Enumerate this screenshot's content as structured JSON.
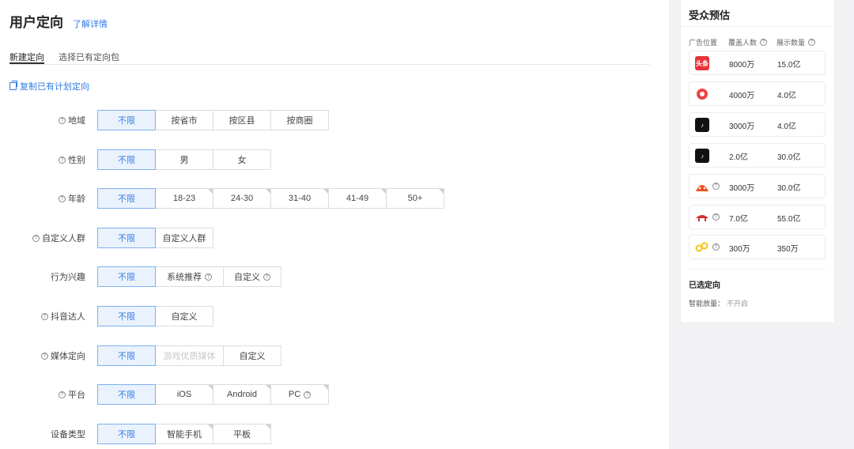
{
  "header": {
    "title": "用户定向",
    "detail_link": "了解详情"
  },
  "tabs": [
    {
      "label": "新建定向",
      "active": true
    },
    {
      "label": "选择已有定向包",
      "active": false
    }
  ],
  "copy_link": "复制已有计划定向",
  "rows": [
    {
      "label": "地域",
      "help": true,
      "options": [
        {
          "label": "不限",
          "selected": true
        },
        {
          "label": "按省市"
        },
        {
          "label": "按区县"
        },
        {
          "label": "按商圈"
        }
      ]
    },
    {
      "label": "性别",
      "help": true,
      "options": [
        {
          "label": "不限",
          "selected": true
        },
        {
          "label": "男"
        },
        {
          "label": "女"
        }
      ]
    },
    {
      "label": "年龄",
      "help": true,
      "options": [
        {
          "label": "不限",
          "selected": true
        },
        {
          "label": "18-23",
          "corner": true
        },
        {
          "label": "24-30",
          "corner": true
        },
        {
          "label": "31-40",
          "corner": true
        },
        {
          "label": "41-49",
          "corner": true
        },
        {
          "label": "50+",
          "corner": true
        }
      ]
    },
    {
      "label": "自定义人群",
      "help": true,
      "options": [
        {
          "label": "不限",
          "selected": true
        },
        {
          "label": "自定义人群"
        }
      ]
    },
    {
      "label": "行为兴趣",
      "help": false,
      "options": [
        {
          "label": "不限",
          "selected": true
        },
        {
          "label": "系统推荐",
          "help": true,
          "wide": true
        },
        {
          "label": "自定义",
          "help": true
        }
      ]
    },
    {
      "label": "抖音达人",
      "help": true,
      "options": [
        {
          "label": "不限",
          "selected": true
        },
        {
          "label": "自定义"
        }
      ]
    },
    {
      "label": "媒体定向",
      "help": true,
      "options": [
        {
          "label": "不限",
          "selected": true
        },
        {
          "label": "游戏优质媒体",
          "disabled": true,
          "wide": true
        },
        {
          "label": "自定义"
        }
      ]
    },
    {
      "label": "平台",
      "help": true,
      "options": [
        {
          "label": "不限",
          "selected": true
        },
        {
          "label": "iOS",
          "corner": true
        },
        {
          "label": "Android",
          "corner": true
        },
        {
          "label": "PC",
          "help": true,
          "corner": true
        }
      ]
    },
    {
      "label": "设备类型",
      "help": false,
      "options": [
        {
          "label": "不限",
          "selected": true
        },
        {
          "label": "智能手机",
          "corner": true
        },
        {
          "label": "平板",
          "corner": true
        }
      ]
    }
  ],
  "estimate": {
    "title": "受众预估",
    "columns": {
      "position": "广告位置",
      "coverage": "覆盖人数",
      "impressions": "展示数量"
    },
    "media": [
      {
        "icon": "toutiao-icon",
        "icon_text": "头条",
        "color": "#e8333a",
        "coverage": "8000万",
        "impressions": "15.0亿",
        "help": false
      },
      {
        "icon": "xigua-icon",
        "icon_text": "",
        "color": "#f04142",
        "coverage": "4000万",
        "impressions": "4.0亿",
        "help": false
      },
      {
        "icon": "douyin-icon",
        "icon_text": "♪",
        "color": "#111111",
        "coverage": "3000万",
        "impressions": "4.0亿",
        "help": false
      },
      {
        "icon": "douyin-icon",
        "icon_text": "♪",
        "color": "#111111",
        "coverage": "2.0亿",
        "impressions": "30.0亿",
        "help": false
      },
      {
        "icon": "huoshan-icon",
        "icon_text": "",
        "color": "#e8541e",
        "coverage": "3000万",
        "impressions": "30.0亿",
        "help": true
      },
      {
        "icon": "union-icon",
        "icon_text": "",
        "color": "#d72f2f",
        "coverage": "7.0亿",
        "impressions": "55.0亿",
        "help": true
      },
      {
        "icon": "link-icon",
        "icon_text": "",
        "color": "#f5c316",
        "coverage": "300万",
        "impressions": "350万",
        "help": true
      }
    ],
    "selected_title": "已选定向",
    "smart_label": "智能放量：",
    "smart_value": "不开启"
  }
}
